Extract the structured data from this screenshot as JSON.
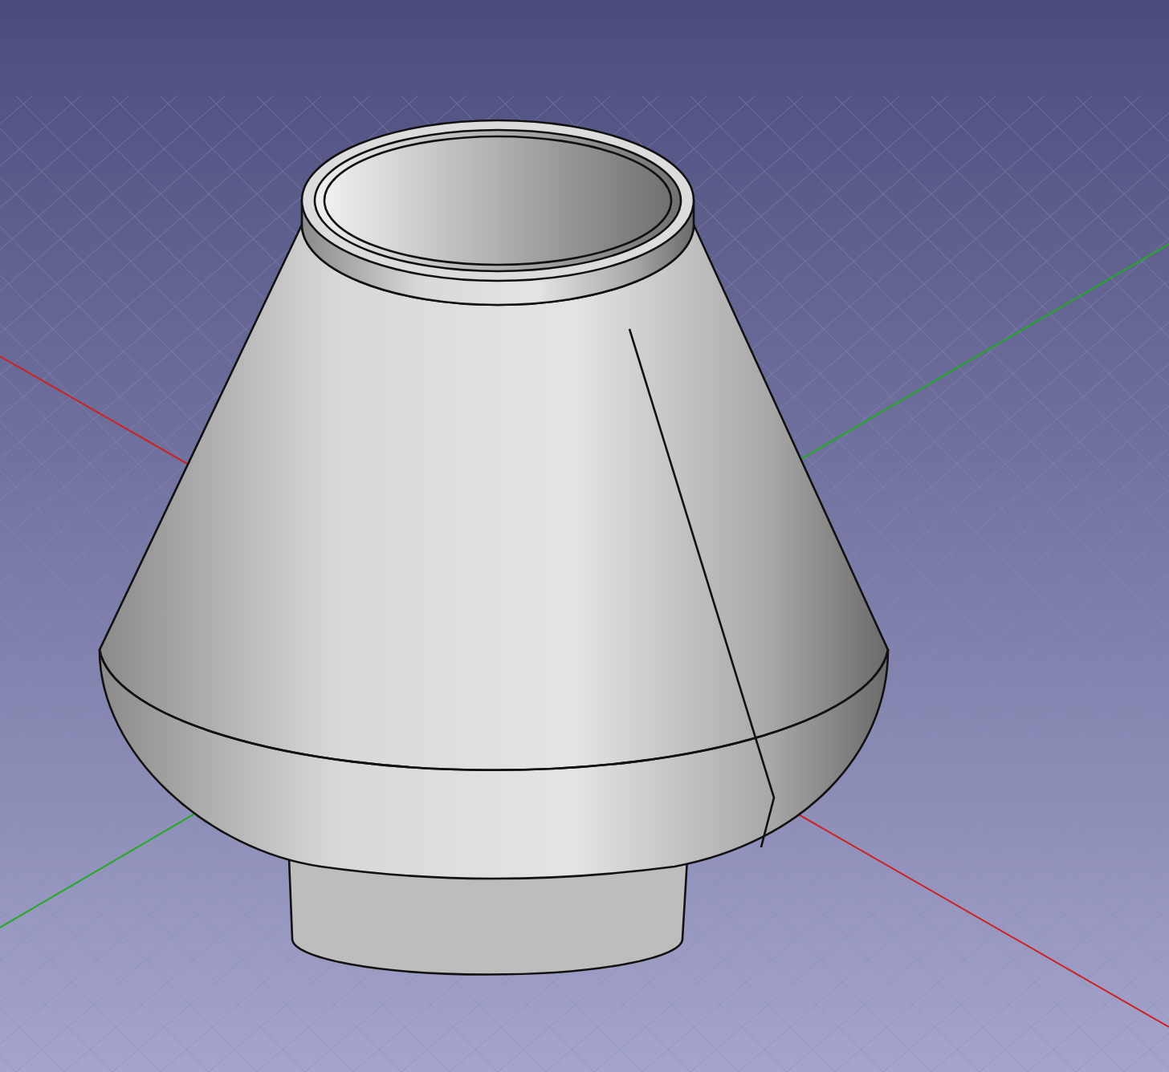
{
  "viewport": {
    "grid": true,
    "axes": [
      {
        "color": "#cc2222"
      },
      {
        "color": "#22aa22"
      }
    ]
  }
}
